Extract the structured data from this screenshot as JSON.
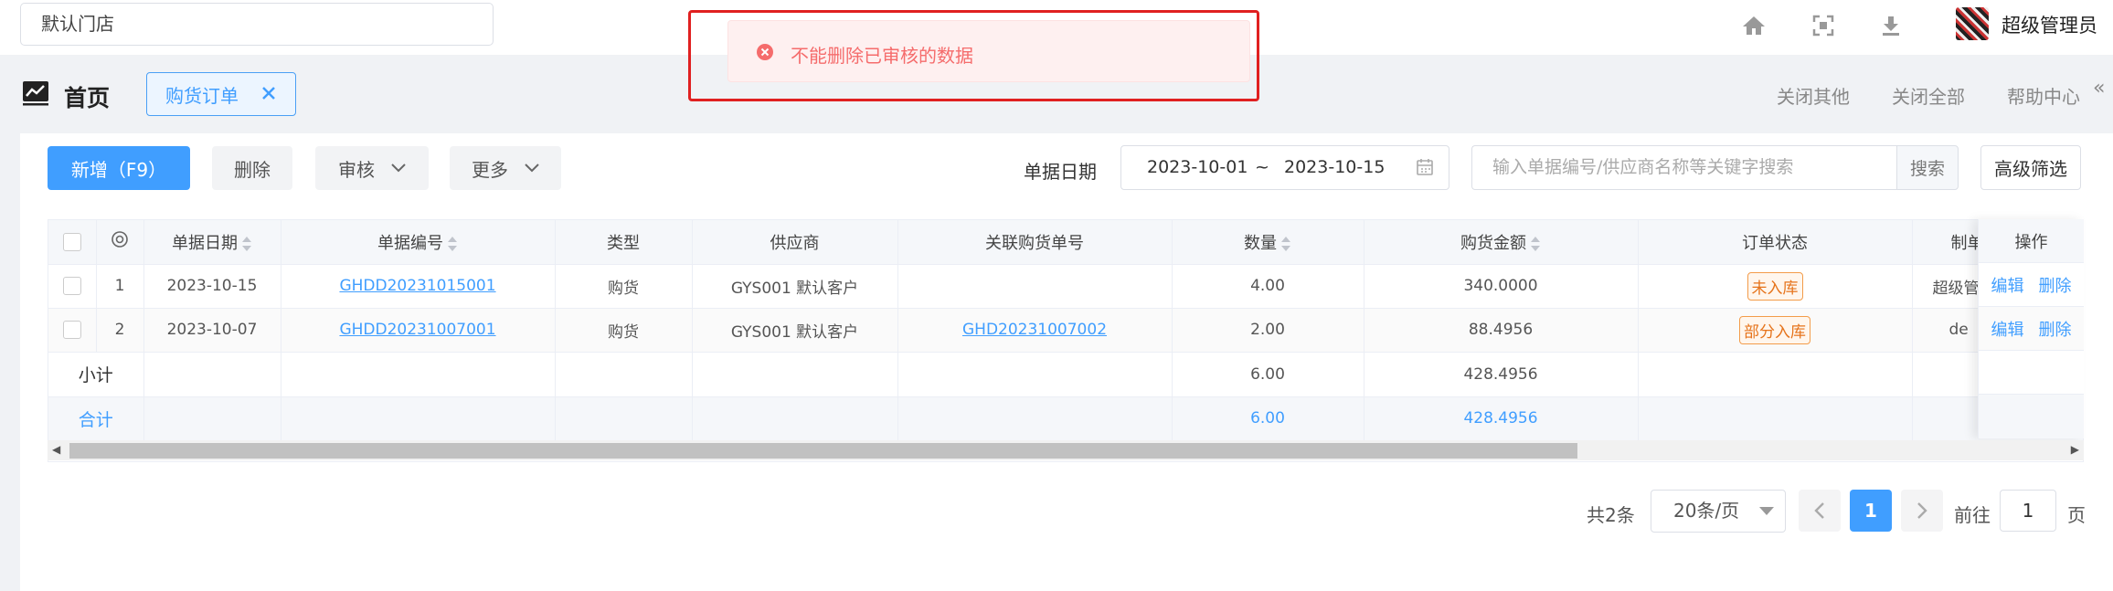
{
  "topbar": {
    "store": "默认门店",
    "username": "超级管理员",
    "icons": [
      "home-icon",
      "fullscreen-icon",
      "download-icon"
    ]
  },
  "toast": {
    "message": "不能删除已审核的数据"
  },
  "header": {
    "title": "首页",
    "active_tab": "购货订单",
    "close_others": "关闭其他",
    "close_all": "关闭全部",
    "help": "帮助中心"
  },
  "toolbar": {
    "add": "新增（F9）",
    "delete": "删除",
    "audit": "审核",
    "more": "更多",
    "date_label": "单据日期",
    "date_from": "2023-10-01",
    "date_sep": "~",
    "date_to": "2023-10-15",
    "search_placeholder": "输入单据编号/供应商名称等关键字搜索",
    "search": "搜索",
    "advanced": "高级筛选"
  },
  "table": {
    "headers": {
      "date": "单据日期",
      "no": "单据编号",
      "type": "类型",
      "supplier": "供应商",
      "related": "关联购货单号",
      "qty": "数量",
      "amount": "购货金额",
      "status": "订单状态",
      "maker": "制单",
      "ops": "操作"
    },
    "rows": [
      {
        "idx": "1",
        "date": "2023-10-15",
        "no": "GHDD20231015001",
        "type": "购货",
        "supplier": "GYS001 默认客户",
        "related": "",
        "qty": "4.00",
        "amount": "340.0000",
        "status": "未入库",
        "maker": "超级管",
        "edit": "编辑",
        "del": "删除"
      },
      {
        "idx": "2",
        "date": "2023-10-07",
        "no": "GHDD20231007001",
        "type": "购货",
        "supplier": "GYS001 默认客户",
        "related": "GHD20231007002",
        "qty": "2.00",
        "amount": "88.4956",
        "status": "部分入库",
        "maker": "de",
        "edit": "编辑",
        "del": "删除"
      }
    ],
    "subtotal": {
      "label": "小计",
      "qty": "6.00",
      "amount": "428.4956"
    },
    "total": {
      "label": "合计",
      "qty": "6.00",
      "amount": "428.4956"
    }
  },
  "pagination": {
    "total": "共2条",
    "page_size": "20条/页",
    "current": "1",
    "goto_label": "前往",
    "goto_value": "1",
    "page_unit": "页"
  },
  "colors": {
    "primary": "#409eff",
    "error": "#f56c6c",
    "warning": "#e6731a"
  }
}
